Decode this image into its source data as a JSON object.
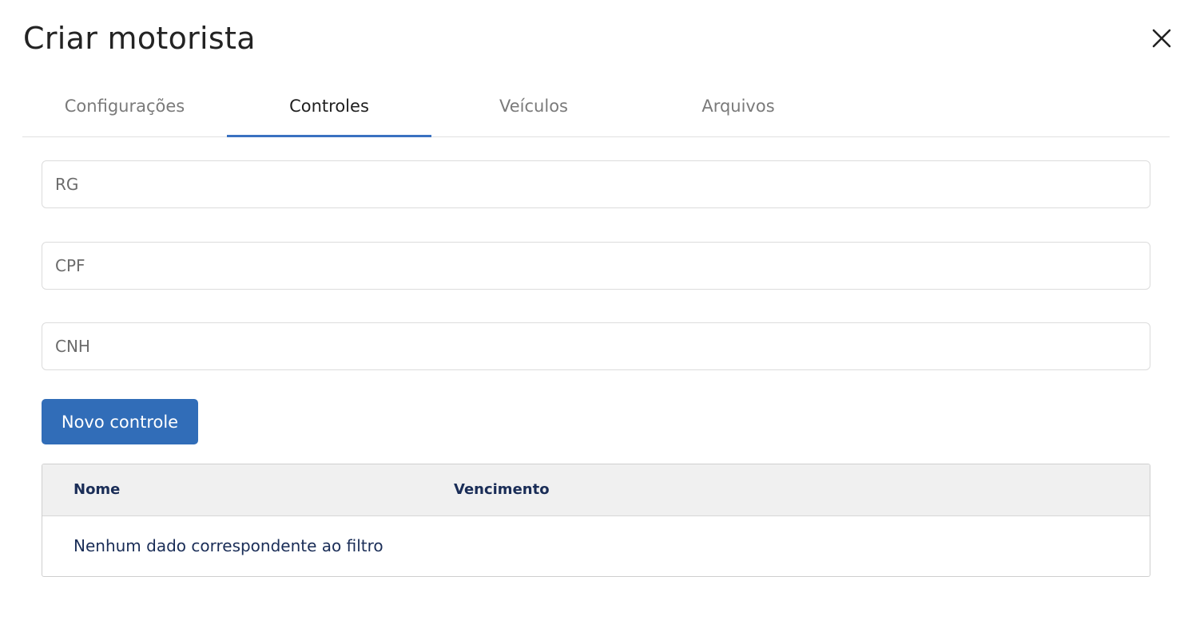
{
  "dialog": {
    "title": "Criar motorista",
    "close_icon": "close-icon"
  },
  "tabs": [
    {
      "label": "Configurações",
      "active": false
    },
    {
      "label": "Controles",
      "active": true
    },
    {
      "label": "Veículos",
      "active": false
    },
    {
      "label": "Arquivos",
      "active": false
    }
  ],
  "form": {
    "rg": {
      "placeholder": "RG",
      "value": ""
    },
    "cpf": {
      "placeholder": "CPF",
      "value": ""
    },
    "cnh": {
      "placeholder": "CNH",
      "value": ""
    }
  },
  "actions": {
    "new_control_label": "Novo controle"
  },
  "table": {
    "columns": [
      "Nome",
      "Vencimento"
    ],
    "rows": [],
    "empty_message": "Nenhum dado correspondente ao filtro"
  },
  "colors": {
    "accent": "#316db8",
    "tab_indicator": "#3a71c1",
    "table_text": "#1a2d57",
    "table_header_bg": "#f0f0f0"
  }
}
